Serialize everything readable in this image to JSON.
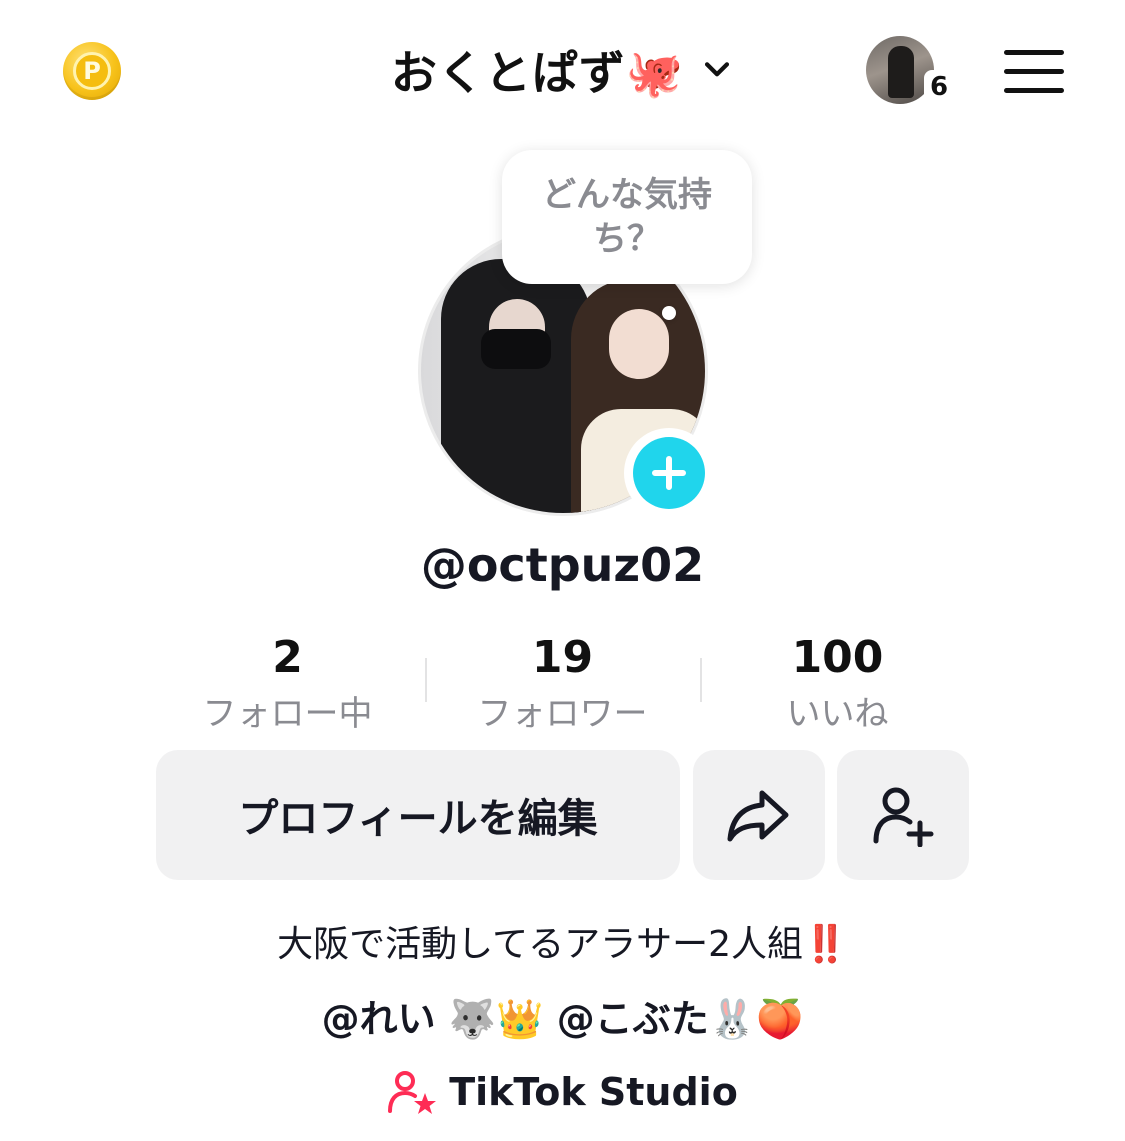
{
  "header": {
    "coin_label": "P",
    "title": "おくとぱず🐙",
    "account_badge_count": "6"
  },
  "bubble": {
    "text": "どんな気持ち？"
  },
  "profile": {
    "username": "@octpuz02"
  },
  "stats": [
    {
      "value": "2",
      "label": "フォロー中"
    },
    {
      "value": "19",
      "label": "フォロワー"
    },
    {
      "value": "100",
      "label": "いいね"
    }
  ],
  "actions": {
    "edit_label": "プロフィールを編集"
  },
  "bio": {
    "line1": "大阪で活動してるアラサー2人組‼️",
    "line2": "@れい 🐺👑 @こぶた🐰🍑"
  },
  "studio": {
    "label": "TikTok Studio"
  },
  "colors": {
    "accent": "#20d5ec",
    "studio_icon": "#fe2c55",
    "coin": "#f7c21a"
  }
}
